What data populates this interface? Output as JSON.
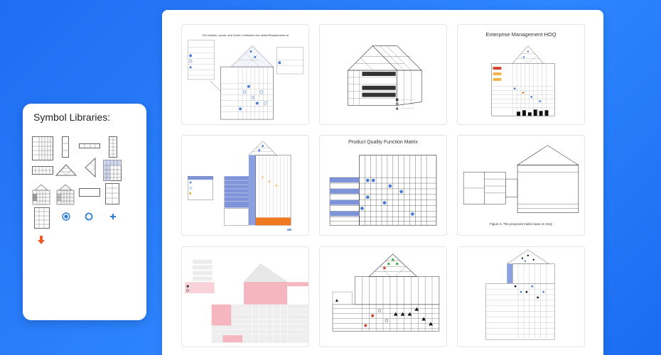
{
  "symbol_panel": {
    "title": "Symbol Libraries:",
    "symbols": [
      "hoq-matrix-grid",
      "vertical-bar",
      "horizontal-bar",
      "vertical-grid",
      "horizontal-grid",
      "triangle-roof",
      "left-triangle",
      "colored-grid",
      "house-diagram",
      "house-diagram-shaded",
      "empty-rectangle",
      "table-grid",
      "table-large",
      "filled-circle-icon",
      "ring-icon",
      "plus-icon",
      "arrow-down-icon"
    ]
  },
  "templates": [
    {
      "id": "t1",
      "title": "The relation, words, and Order of between the action/Requirement at"
    },
    {
      "id": "t2",
      "title": ""
    },
    {
      "id": "t3",
      "title": "Enterprise Management HOQ"
    },
    {
      "id": "t4",
      "title": ""
    },
    {
      "id": "t5",
      "title": "Product Quality Function Matrix"
    },
    {
      "id": "t6",
      "title": "Figure 3. The proposed matrix base on HoQ"
    },
    {
      "id": "t7",
      "title": ""
    },
    {
      "id": "t8",
      "title": ""
    },
    {
      "id": "t9",
      "title": ""
    }
  ],
  "colors": {
    "background": "#2279f5",
    "accent_blue": "#4a7bd6",
    "orange": "#f07a22",
    "pink": "#f5b6bf",
    "green": "#49b34a"
  }
}
